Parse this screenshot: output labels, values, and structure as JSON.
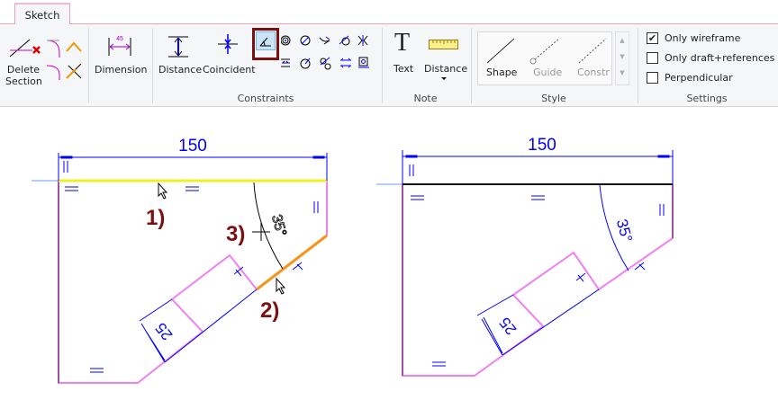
{
  "tabs": [
    {
      "label": "Sketch",
      "active": true
    }
  ],
  "ribbon": {
    "groups": [
      {
        "label": "",
        "items": [
          {
            "label": "Delete Section",
            "line1": "Delete",
            "line2": "Section"
          }
        ]
      },
      {
        "label": "",
        "items": [
          {
            "label": "Dimension",
            "icon_value": "45"
          }
        ]
      },
      {
        "label": "Constraints",
        "items": [
          {
            "label": "Distance"
          },
          {
            "label": "Coincident"
          },
          {
            "label": "Angle",
            "selected": true
          }
        ]
      },
      {
        "label": "Note",
        "items": [
          {
            "label": "Text",
            "icon_glyph": "T"
          },
          {
            "label": "Distance"
          }
        ]
      },
      {
        "label": "Style",
        "items": [
          {
            "label": "Shape"
          },
          {
            "label": "Guide"
          },
          {
            "label": "Constr"
          }
        ]
      },
      {
        "label": "Settings"
      }
    ],
    "settings": [
      {
        "label": "Only wireframe",
        "checked": true
      },
      {
        "label": "Only draft+references",
        "checked": false
      },
      {
        "label": "Perpendicular",
        "checked": false
      }
    ]
  },
  "canvas": {
    "left": {
      "dimension": "150",
      "width_dim": "25",
      "angle_dim": "35°",
      "steps": [
        "1)",
        "2)",
        "3)"
      ]
    },
    "right": {
      "dimension": "150",
      "width_dim": "25",
      "angle_dim": "35°"
    }
  },
  "colors": {
    "selected_edge": "#f0f020",
    "hover_edge": "#f7941d",
    "shape": "#f080f0",
    "dimension": "#0000ff",
    "step_label": "#7a1010",
    "highlight_box": "#7a1010"
  }
}
